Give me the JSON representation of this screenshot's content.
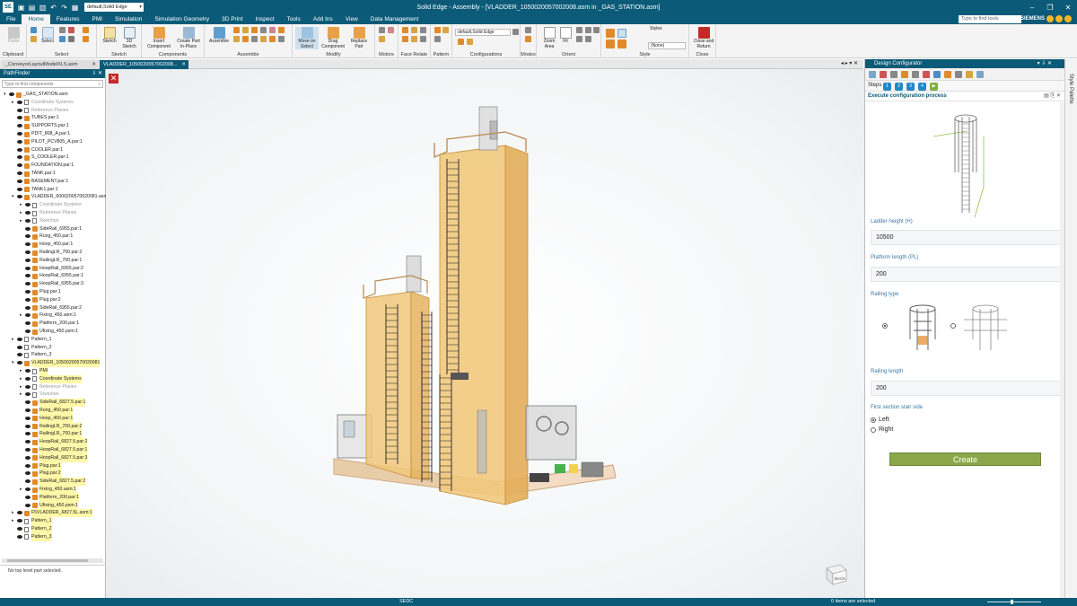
{
  "titlebar": {
    "app_icon": "SE",
    "template_value": "default,Solid Edge",
    "title": "Solid Edge - Assembly - [VLADDER_1050020057002008.asm in _GAS_STATION.asm]",
    "icons": [
      "save-icon",
      "open-icon",
      "print-icon",
      "undo-icon",
      "redo-icon",
      "new-icon"
    ]
  },
  "ribbon_tabs": [
    "File",
    "Home",
    "Features",
    "PMI",
    "Simulation",
    "Simulation Geometry",
    "3D Print",
    "Inspect",
    "Tools",
    "Add Ins",
    "View",
    "Data Management"
  ],
  "active_tab": "Home",
  "tools_search_placeholder": "Type to find tools",
  "brand": "SIEMENS",
  "ribbon": {
    "groups": [
      {
        "label": "Clipboard",
        "buttons": [
          "Paste"
        ]
      },
      {
        "label": "Select",
        "buttons": [
          "Select"
        ]
      },
      {
        "label": "Sketch",
        "buttons": [
          "Sketch",
          "3D Sketch"
        ]
      },
      {
        "label": "Components",
        "buttons": [
          "Insert Component",
          "Create Part In-Place"
        ]
      },
      {
        "label": "Assemble",
        "buttons": [
          "Assemble"
        ]
      },
      {
        "label": "Modify",
        "buttons": [
          "Move on Select",
          "Drag Component",
          "Replace Part"
        ]
      },
      {
        "label": "Motors",
        "buttons": []
      },
      {
        "label": "Face Relate",
        "buttons": []
      },
      {
        "label": "Pattern",
        "buttons": []
      },
      {
        "label": "Configurations",
        "buttons": []
      },
      {
        "label": "Modes",
        "buttons": []
      },
      {
        "label": "Orient",
        "buttons": [
          "Zoom Area",
          "Fit"
        ]
      },
      {
        "label": "Style",
        "buttons": []
      },
      {
        "label": "Close",
        "buttons": [
          "Close and Return"
        ]
      }
    ],
    "config_select": "default,Solid Edge",
    "styles_label": "Styles",
    "style_select": "(None)"
  },
  "doc_tabs": [
    {
      "label": "_ConveyorLayoutModelXLS.asm",
      "active": false
    },
    {
      "label": "VLADDER_1050020057002008...",
      "active": true
    }
  ],
  "pathfinder": {
    "title": "PathFinder",
    "search_placeholder": "Type to find components",
    "status": "No top level part selected.",
    "rows": [
      {
        "level": 0,
        "text": "_GAS_STATION.asm",
        "exp": "▾",
        "kind": "asm"
      },
      {
        "level": 1,
        "text": "Coordinate Systems",
        "exp": "▸",
        "kind": "sys",
        "dim": true
      },
      {
        "level": 1,
        "text": "Reference Planes",
        "exp": "",
        "kind": "sys",
        "dim": true
      },
      {
        "level": 1,
        "text": "TUBES.par:1",
        "exp": "",
        "kind": "part"
      },
      {
        "level": 1,
        "text": "SUPPORTS.par:1",
        "exp": "",
        "kind": "part"
      },
      {
        "level": 1,
        "text": "PDIT_808_A.par:1",
        "exp": "",
        "kind": "part"
      },
      {
        "level": 1,
        "text": "PILOT_PCV805_A.par:1",
        "exp": "",
        "kind": "part"
      },
      {
        "level": 1,
        "text": "COOLER.par:1",
        "exp": "",
        "kind": "part"
      },
      {
        "level": 1,
        "text": "S_COOLER.par:1",
        "exp": "",
        "kind": "part"
      },
      {
        "level": 1,
        "text": "FOUNDATION.par:1",
        "exp": "",
        "kind": "part"
      },
      {
        "level": 1,
        "text": "TANK.par:1",
        "exp": "",
        "kind": "part"
      },
      {
        "level": 1,
        "text": "BASEMENT.par:1",
        "exp": "",
        "kind": "part"
      },
      {
        "level": 1,
        "text": "TANK1.par:1",
        "exp": "",
        "kind": "part"
      },
      {
        "level": 1,
        "text": "VLADDER_6000200570020081.asm",
        "exp": "▾",
        "kind": "asm"
      },
      {
        "level": 2,
        "text": "Coordinate Systems",
        "exp": "▸",
        "kind": "sys",
        "dim": true
      },
      {
        "level": 2,
        "text": "Reference Planes",
        "exp": "▸",
        "kind": "sys",
        "dim": true
      },
      {
        "level": 2,
        "text": "Sketches",
        "exp": "▸",
        "kind": "sys",
        "dim": true
      },
      {
        "level": 2,
        "text": "SideRail_6955.par:1",
        "exp": "",
        "kind": "part"
      },
      {
        "level": 2,
        "text": "Rung_450.par:1",
        "exp": "",
        "kind": "part"
      },
      {
        "level": 2,
        "text": "Hoop_450.par:1",
        "exp": "",
        "kind": "part"
      },
      {
        "level": 2,
        "text": "RailingLR_700.par:2",
        "exp": "",
        "kind": "part"
      },
      {
        "level": 2,
        "text": "RailingLR_700.par:1",
        "exp": "",
        "kind": "part"
      },
      {
        "level": 2,
        "text": "HoopRail_6955.par:2",
        "exp": "",
        "kind": "part"
      },
      {
        "level": 2,
        "text": "HoopRail_6955.par:1",
        "exp": "",
        "kind": "part"
      },
      {
        "level": 2,
        "text": "HoopRail_6955.par:3",
        "exp": "",
        "kind": "part"
      },
      {
        "level": 2,
        "text": "Plug.par:1",
        "exp": "",
        "kind": "part"
      },
      {
        "level": 2,
        "text": "Plug.par:2",
        "exp": "",
        "kind": "part"
      },
      {
        "level": 2,
        "text": "SideRail_6955.par:2",
        "exp": "",
        "kind": "part"
      },
      {
        "level": 2,
        "text": "Fixing_450.asm:1",
        "exp": "▸",
        "kind": "asm"
      },
      {
        "level": 2,
        "text": "Platform_200.par:1",
        "exp": "",
        "kind": "part"
      },
      {
        "level": 2,
        "text": "Ufixing_450.psm:1",
        "exp": "",
        "kind": "part"
      },
      {
        "level": 1,
        "text": "Pattern_1",
        "exp": "▸",
        "kind": "pat"
      },
      {
        "level": 1,
        "text": "Pattern_2",
        "exp": "",
        "kind": "pat"
      },
      {
        "level": 1,
        "text": "Pattern_3",
        "exp": "",
        "kind": "pat"
      },
      {
        "level": 1,
        "text": "VLADDER_10500200570020081",
        "exp": "▾",
        "kind": "asm",
        "hl": true
      },
      {
        "level": 2,
        "text": "PMI",
        "exp": "▸",
        "kind": "sys",
        "hl": true
      },
      {
        "level": 2,
        "text": "Coordinate Systems",
        "exp": "▸",
        "kind": "sys",
        "hl": true
      },
      {
        "level": 2,
        "text": "Reference Planes",
        "exp": "▸",
        "kind": "sys",
        "dim": true
      },
      {
        "level": 2,
        "text": "Sketches",
        "exp": "▸",
        "kind": "sys",
        "dim": true
      },
      {
        "level": 2,
        "text": "SideRail_6827.5.par:1",
        "exp": "",
        "kind": "part",
        "hl": true
      },
      {
        "level": 2,
        "text": "Rung_450.par:1",
        "exp": "",
        "kind": "part",
        "hl": true
      },
      {
        "level": 2,
        "text": "Hoop_450.par:1",
        "exp": "",
        "kind": "part",
        "hl": true
      },
      {
        "level": 2,
        "text": "RailingLR_700.par:2",
        "exp": "",
        "kind": "part",
        "hl": true
      },
      {
        "level": 2,
        "text": "RailingLR_700.par:1",
        "exp": "",
        "kind": "part",
        "hl": true
      },
      {
        "level": 2,
        "text": "HoopRail_6827.5.par:2",
        "exp": "",
        "kind": "part",
        "hl": true
      },
      {
        "level": 2,
        "text": "HoopRail_6827.5.par:1",
        "exp": "",
        "kind": "part",
        "hl": true
      },
      {
        "level": 2,
        "text": "HoopRail_6827.5.par:3",
        "exp": "",
        "kind": "part",
        "hl": true
      },
      {
        "level": 2,
        "text": "Plug.par:1",
        "exp": "",
        "kind": "part",
        "hl": true
      },
      {
        "level": 2,
        "text": "Plug.par:2",
        "exp": "",
        "kind": "part",
        "hl": true
      },
      {
        "level": 2,
        "text": "SideRail_6827.5.par:2",
        "exp": "",
        "kind": "part",
        "hl": true
      },
      {
        "level": 2,
        "text": "Fixing_450.asm:1",
        "exp": "▸",
        "kind": "asm",
        "hl": true
      },
      {
        "level": 2,
        "text": "Platform_200.par:1",
        "exp": "",
        "kind": "part",
        "hl": true
      },
      {
        "level": 2,
        "text": "Ufixing_450.psm:1",
        "exp": "",
        "kind": "part",
        "hl": true
      },
      {
        "level": 1,
        "text": "F5VLADDER_6827.5L.asm:1",
        "exp": "▸",
        "kind": "asm",
        "hl": true
      },
      {
        "level": 1,
        "text": "Pattern_1",
        "exp": "▸",
        "kind": "pat",
        "hl": true
      },
      {
        "level": 1,
        "text": "Pattern_2",
        "exp": "",
        "kind": "pat",
        "hl": true
      },
      {
        "level": 1,
        "text": "Pattern_3",
        "exp": "",
        "kind": "pat",
        "hl": true
      }
    ]
  },
  "design_configurator": {
    "title": "Design Configurator",
    "steps_label": "Steps",
    "steps": [
      "1",
      "2",
      "3",
      "4"
    ],
    "section_title": "Execute configuration process",
    "ladder_height_label": "Ladder height (H)",
    "ladder_height_value": "10500",
    "platform_length_label": "Platform length (PL)",
    "platform_length_value": "200",
    "railing_type_label": "Railing type",
    "railing_length_label": "Railing length",
    "railing_length_value": "200",
    "stair_side_label": "First section stair side",
    "stair_side_options": [
      "Left",
      "Right"
    ],
    "stair_side_selected": "Left",
    "create_label": "Create",
    "side_tab_label": "Style Palette"
  },
  "viewcube_label": "BACK",
  "status": {
    "center": "SEDC",
    "selection": "0 items are selected"
  },
  "colors": {
    "accent": "#0a5a78",
    "create_button": "#8aa84a",
    "step": "#1e88c8",
    "tank": "#f0c77a",
    "highlight_row": "#fff8a8"
  }
}
